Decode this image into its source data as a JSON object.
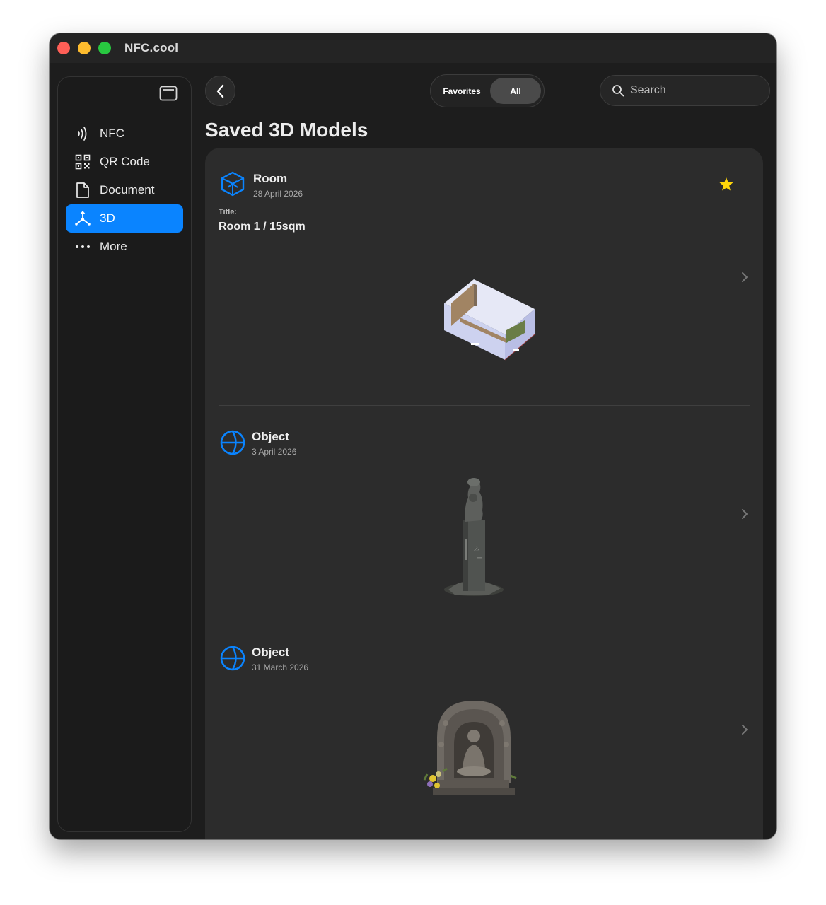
{
  "window": {
    "title": "NFC.cool"
  },
  "sidebar": {
    "items": [
      {
        "label": "NFC",
        "icon": "nfc-icon",
        "active": false
      },
      {
        "label": "QR Code",
        "icon": "qr-code-icon",
        "active": false
      },
      {
        "label": "Document",
        "icon": "document-icon",
        "active": false
      },
      {
        "label": "3D",
        "icon": "3d-axis-icon",
        "active": true
      },
      {
        "label": "More",
        "icon": "ellipsis-icon",
        "active": false
      }
    ]
  },
  "toolbar": {
    "segments": {
      "favorites": "Favorites",
      "all": "All",
      "selected": "All"
    },
    "search": {
      "placeholder": "Search",
      "value": ""
    }
  },
  "main": {
    "title": "Saved 3D Models",
    "items": [
      {
        "type": "Room",
        "date": "28 April 2026",
        "title_label": "Title:",
        "title": "Room 1 / 15sqm",
        "favorite": true
      },
      {
        "type": "Object",
        "date": "3 April 2026",
        "favorite": false
      },
      {
        "type": "Object",
        "date": "31 March 2026",
        "favorite": false
      }
    ]
  },
  "colors": {
    "accent": "#0a84ff",
    "star": "#ffd60a",
    "background": "#1d1d1d",
    "panel": "#2c2c2c"
  }
}
